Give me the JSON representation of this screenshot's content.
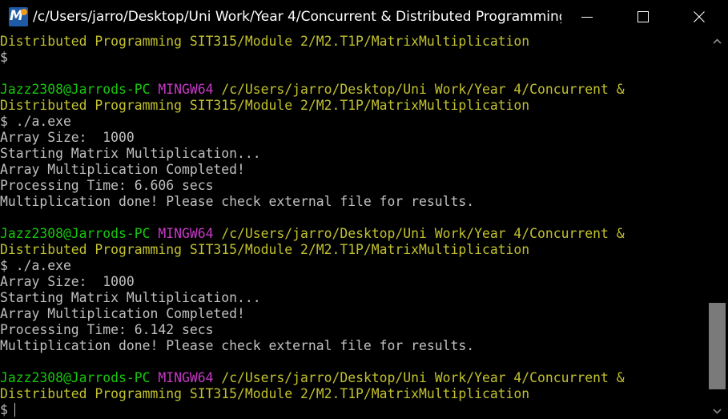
{
  "window": {
    "title": "/c/Users/jarro/Desktop/Uni Work/Year 4/Concurrent & Distributed Programming ...",
    "app_icon_letter": "M",
    "app_icon_name": "mintty-terminal-icon",
    "controls": {
      "minimize_icon": "minimize-icon",
      "maximize_icon": "maximize-icon",
      "close_icon": "close-icon"
    }
  },
  "colors": {
    "background": "#000000",
    "path_yellow": "#c2c12f",
    "user_green": "#16c60c",
    "mingw_magenta": "#c639c6",
    "text_gray": "#c0c0c0"
  },
  "terminal": {
    "lines": [
      [
        {
          "text": "Distributed Programming SIT315/Module 2/M2.T1P/MatrixMultiplication",
          "style": "yellow"
        }
      ],
      [
        {
          "text": "$",
          "style": "plain"
        }
      ],
      [],
      [
        {
          "text": "Jazz2308@Jarrods-PC",
          "style": "green"
        },
        {
          "text": " ",
          "style": "plain"
        },
        {
          "text": "MINGW64",
          "style": "magenta"
        },
        {
          "text": " /c/Users/jarro/Desktop/Uni Work/Year 4/Concurrent &",
          "style": "yellow"
        }
      ],
      [
        {
          "text": "Distributed Programming SIT315/Module 2/M2.T1P/MatrixMultiplication",
          "style": "yellow"
        }
      ],
      [
        {
          "text": "$ ./a.exe",
          "style": "plain"
        }
      ],
      [
        {
          "text": "Array Size:  1000",
          "style": "plain"
        }
      ],
      [
        {
          "text": "Starting Matrix Multiplication...",
          "style": "plain"
        }
      ],
      [
        {
          "text": "Array Multiplication Completed!",
          "style": "plain"
        }
      ],
      [
        {
          "text": "Processing Time: 6.606 secs",
          "style": "plain"
        }
      ],
      [
        {
          "text": "Multiplication done! Please check external file for results.",
          "style": "plain"
        }
      ],
      [],
      [
        {
          "text": "Jazz2308@Jarrods-PC",
          "style": "green"
        },
        {
          "text": " ",
          "style": "plain"
        },
        {
          "text": "MINGW64",
          "style": "magenta"
        },
        {
          "text": " /c/Users/jarro/Desktop/Uni Work/Year 4/Concurrent &",
          "style": "yellow"
        }
      ],
      [
        {
          "text": "Distributed Programming SIT315/Module 2/M2.T1P/MatrixMultiplication",
          "style": "yellow"
        }
      ],
      [
        {
          "text": "$ ./a.exe",
          "style": "plain"
        }
      ],
      [
        {
          "text": "Array Size:  1000",
          "style": "plain"
        }
      ],
      [
        {
          "text": "Starting Matrix Multiplication...",
          "style": "plain"
        }
      ],
      [
        {
          "text": "Array Multiplication Completed!",
          "style": "plain"
        }
      ],
      [
        {
          "text": "Processing Time: 6.142 secs",
          "style": "plain"
        }
      ],
      [
        {
          "text": "Multiplication done! Please check external file for results.",
          "style": "plain"
        }
      ],
      [],
      [
        {
          "text": "Jazz2308@Jarrods-PC",
          "style": "green"
        },
        {
          "text": " ",
          "style": "plain"
        },
        {
          "text": "MINGW64",
          "style": "magenta"
        },
        {
          "text": " /c/Users/jarro/Desktop/Uni Work/Year 4/Concurrent &",
          "style": "yellow"
        }
      ],
      [
        {
          "text": "Distributed Programming SIT315/Module 2/M2.T1P/MatrixMultiplication",
          "style": "yellow"
        }
      ]
    ],
    "prompt": {
      "symbol": "$"
    }
  },
  "scrollbar": {
    "up_icon": "scroll-up-arrow-icon",
    "down_icon": "scroll-down-arrow-icon",
    "position": 0.95
  }
}
